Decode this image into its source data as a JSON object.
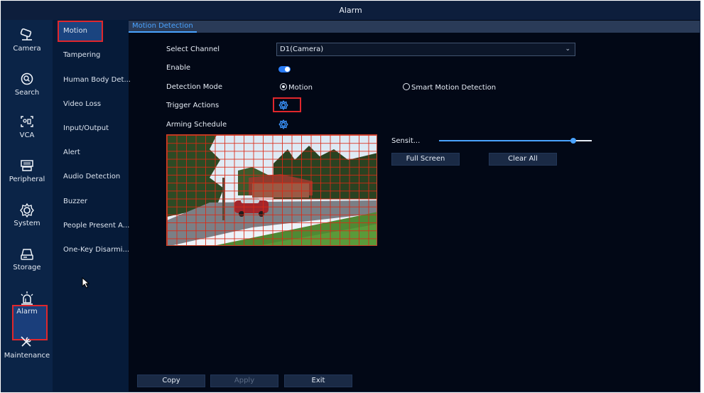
{
  "window": {
    "title": "Alarm"
  },
  "leftnav": {
    "items": [
      {
        "label": "Camera",
        "icon": "camera-icon",
        "glyph": "⌕"
      },
      {
        "label": "Search",
        "icon": "search-icon",
        "glyph": "⌾"
      },
      {
        "label": "VCA",
        "icon": "vca-icon",
        "glyph": "⛶"
      },
      {
        "label": "Peripheral",
        "icon": "peripheral-icon",
        "glyph": "▦"
      },
      {
        "label": "System",
        "icon": "system-gear-icon",
        "glyph": "⚙"
      },
      {
        "label": "Storage",
        "icon": "storage-icon",
        "glyph": "⛁"
      },
      {
        "label": "Alarm",
        "icon": "alarm-icon",
        "glyph": "⚠"
      },
      {
        "label": "Maintenance",
        "icon": "maintenance-icon",
        "glyph": "✂"
      }
    ],
    "active": "Alarm"
  },
  "subnav": {
    "items": [
      "Motion",
      "Tampering",
      "Human Body Det...",
      "Video Loss",
      "Input/Output",
      "Alert",
      "Audio Detection",
      "Buzzer",
      "People Present A...",
      "One-Key Disarmi..."
    ],
    "active": "Motion"
  },
  "tabs": {
    "active": "Motion Detection"
  },
  "form": {
    "select_channel_label": "Select Channel",
    "select_channel_value": "D1(Camera)",
    "enable_label": "Enable",
    "enable_on": true,
    "detection_mode_label": "Detection Mode",
    "mode_motion": "Motion",
    "mode_smart": "Smart Motion Detection",
    "mode_selected": "Motion",
    "trigger_actions_label": "Trigger Actions",
    "arming_schedule_label": "Arming Schedule"
  },
  "detection_area": {
    "sensitivity_label": "Sensit...",
    "sensitivity_level": 0.88,
    "full_screen_label": "Full Screen",
    "clear_all_label": "Clear All"
  },
  "footer": {
    "copy_label": "Copy",
    "apply_label": "Apply",
    "exit_label": "Exit"
  },
  "colors": {
    "accent": "#3b95ff",
    "highlight_box": "#e0272c",
    "grid": "#dc2814"
  }
}
